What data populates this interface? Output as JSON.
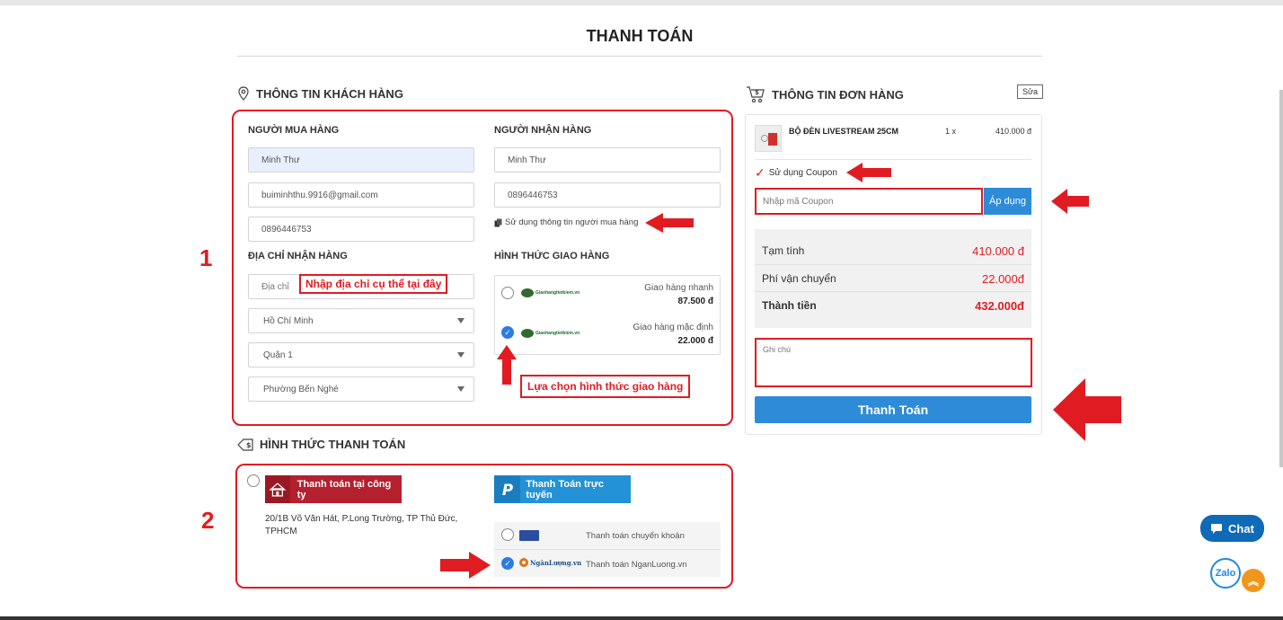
{
  "page": {
    "title": "THANH TOÁN"
  },
  "customer": {
    "section_title": "THÔNG TIN KHÁCH HÀNG",
    "buyer": {
      "heading": "NGƯỜI MUA HÀNG",
      "name": "Minh Thư",
      "email": "buiminhthu.9916@gmail.com",
      "phone": "0896446753"
    },
    "receiver": {
      "heading": "NGƯỜI NHẬN HÀNG",
      "name": "Minh Thư",
      "phone": "0896446753",
      "use_buyer_info": "Sử dụng thông tin người mua hàng"
    },
    "address": {
      "heading": "ĐỊA CHỈ NHẬN HÀNG",
      "placeholder": "Địa chỉ",
      "city": "Hồ Chí Minh",
      "district": "Quận 1",
      "ward": "Phường Bến Nghé"
    },
    "shipping": {
      "heading": "HÌNH THỨC GIAO HÀNG",
      "logo_text": "Giaohangtietkiem.vn",
      "options": [
        {
          "name": "Giao hàng nhanh",
          "price": "87.500 đ",
          "selected": false
        },
        {
          "name": "Giao hàng mặc định",
          "price": "22.000 đ",
          "selected": true
        }
      ]
    }
  },
  "payment": {
    "section_title": "HÌNH THỨC THANH TOÁN",
    "company": {
      "label": "Thanh toán tại công ty",
      "address": "20/1B Võ Văn Hát, P.Long Trường, TP Thủ Đức, TPHCM"
    },
    "online": {
      "label": "Thanh Toán trực tuyến",
      "options": [
        {
          "name": "Thanh toán chuyển khoản",
          "selected": false
        },
        {
          "name": "Thanh toán NganLuong.vn",
          "selected": true,
          "logo": "NgânLượng.vn"
        }
      ]
    }
  },
  "order": {
    "section_title": "THÔNG TIN ĐƠN HÀNG",
    "edit_label": "Sửa",
    "item": {
      "name": "BỘ ĐÈN LIVESTREAM 25CM",
      "qty": "1 x",
      "price": "410.000 đ"
    },
    "coupon": {
      "use_label": "Sử dụng Coupon",
      "placeholder": "Nhập mã Coupon",
      "apply_label": "Áp dụng"
    },
    "summary": {
      "subtotal_label": "Tạm tính",
      "subtotal": "410.000 đ",
      "shipping_label": "Phí vận chuyển",
      "shipping": "22.000đ",
      "total_label": "Thành tiền",
      "total": "432.000đ"
    },
    "note_placeholder": "Ghi chú",
    "pay_button": "Thanh Toán"
  },
  "annotations": {
    "number_1": "1",
    "number_2": "2",
    "address_hint": "Nhập địa chỉ cụ thể tại đây",
    "shipping_hint": "Lựa chọn hình thức giao hàng"
  },
  "widgets": {
    "chat": "Chat",
    "zalo": "Zalo"
  },
  "colors": {
    "annotation_red": "#e11b22",
    "primary_blue": "#2e8bd8",
    "company_red": "#b5202e"
  }
}
